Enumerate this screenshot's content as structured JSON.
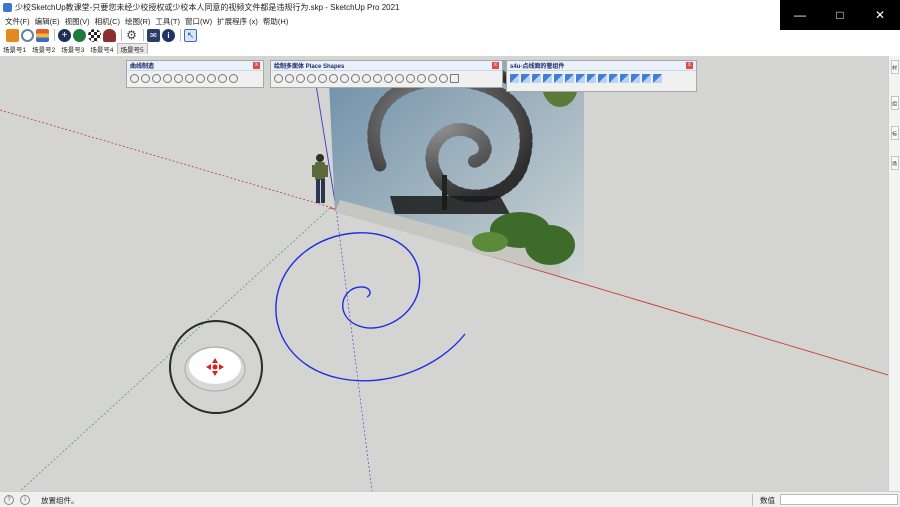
{
  "window": {
    "title": "少校SketchUp教课堂-只要您未经少校授权或少校本人同意的视频文件都是违规行为.skp - SketchUp Pro 2021",
    "minimize_icon": "minimize-icon",
    "maximize_icon": "maximize-icon",
    "close_icon": "close-icon"
  },
  "menu": {
    "items": [
      "文件(F)",
      "编辑(E)",
      "视图(V)",
      "相机(C)",
      "绘图(R)",
      "工具(T)",
      "窗口(W)",
      "扩展程序 (x)",
      "帮助(H)"
    ]
  },
  "toolbar": {
    "icons": [
      "sketchup-logo-icon",
      "refresh-icon",
      "layers-icon",
      "add-circle-icon",
      "tree-icon",
      "checker-icon",
      "cloud-icon",
      "gear-icon",
      "mail-icon",
      "info-icon",
      "select-tool-icon"
    ]
  },
  "scene_tabs": {
    "items": [
      "场景号1",
      "场景号2",
      "场景号3",
      "场景号4",
      "场景号5"
    ],
    "active_index": 4
  },
  "panels": {
    "curve": {
      "title": "曲线制造",
      "close": "x"
    },
    "shapes": {
      "title": "绘制多面体 Place Shapes",
      "close": "x"
    },
    "s4u": {
      "title": "s4u-点线面的管组件",
      "close": "x"
    }
  },
  "right_dock": {
    "tabs": [
      "材",
      "组",
      "标",
      "场"
    ]
  },
  "statusbar": {
    "message": "放置组件。",
    "value_label": "数值",
    "value": ""
  },
  "colors": {
    "viewport_bg": "#d4d4d2",
    "spiral": "#1a2fe0",
    "red_axis": "#c83a2a",
    "blue_axis": "#3a3ac8"
  }
}
